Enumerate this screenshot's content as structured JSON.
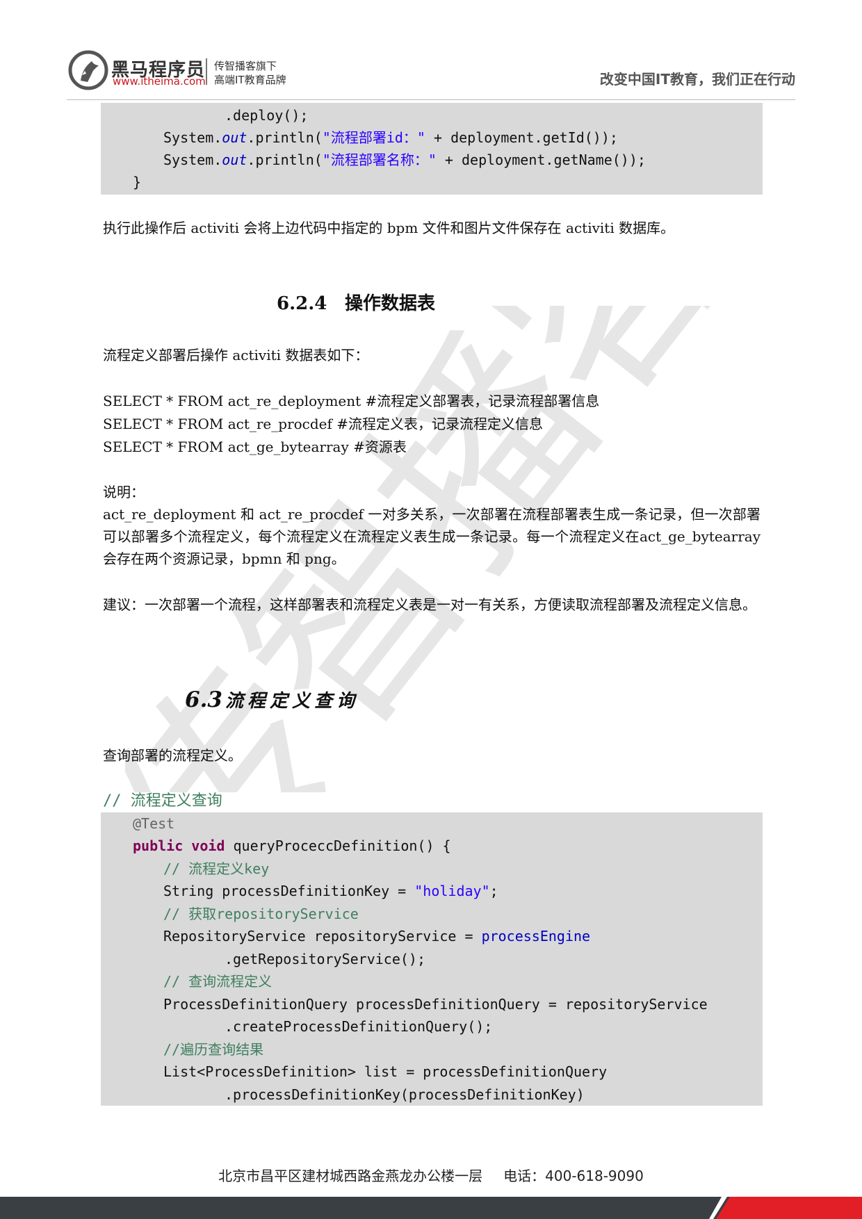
{
  "header": {
    "brand_name": "黑马程序员",
    "brand_url": "www.itheima.com",
    "brand_sub1": "传智播客旗下",
    "brand_sub2": "高端IT教育品牌",
    "slogan": "改变中国IT教育，我们正在行动"
  },
  "watermark_text": "传智播客",
  "code1": {
    "line1": ".deploy();",
    "line2_pre": "System.",
    "line2_field": "out",
    "line2_mid": ".println(",
    "line2_str": "\"流程部署id：\"",
    "line2_post": " + deployment.getId());",
    "line3_pre": "System.",
    "line3_field": "out",
    "line3_mid": ".println(",
    "line3_str": "\"流程部署名称：\"",
    "line3_post": " + deployment.getName());",
    "line4": "}"
  },
  "p_after_deploy": "执行此操作后 activiti 会将上边代码中指定的 bpm 文件和图片文件保存在 activiti 数据库。",
  "section_624": {
    "number": "6.2.4",
    "title": "操作数据表"
  },
  "p_tables_intro": "流程定义部署后操作 activiti 数据表如下：",
  "sql_lines": [
    "SELECT * FROM act_re_deployment #流程定义部署表，记录流程部署信息",
    "SELECT * FROM act_re_procdef #流程定义表，记录流程定义信息",
    "SELECT * FROM act_ge_bytearray #资源表"
  ],
  "note_label": "说明：",
  "note_body": "act_re_deployment 和 act_re_procdef 一对多关系，一次部署在流程部署表生成一条记录，但一次部署可以部署多个流程定义，每个流程定义在流程定义表生成一条记录。每一个流程定义在act_ge_bytearray 会存在两个资源记录，bpmn 和 png。",
  "advice": "建议：一次部署一个流程，这样部署表和流程定义表是一对一有关系，方便读取流程部署及流程定义信息。",
  "section_63": {
    "number": "6.3",
    "title": "流程定义查询"
  },
  "p_query_intro": "查询部署的流程定义。",
  "code_comment": "// 流程定义查询",
  "code2": {
    "ann": "@Test",
    "kw1": "public",
    "kw2": "void",
    "sig": " queryProceccDefinition() {",
    "c1": "// 流程定义key",
    "l2_pre": "String processDefinitionKey = ",
    "l2_str": "\"holiday\"",
    "l2_post": ";",
    "c2": "// 获取repositoryService",
    "l3_pre": "RepositoryService repositoryService = ",
    "l3_field": "processEngine",
    "l4": ".getRepositoryService();",
    "c3": "// 查询流程定义",
    "l5": "ProcessDefinitionQuery processDefinitionQuery = repositoryService",
    "l6": ".createProcessDefinitionQuery();",
    "c4": "//遍历查询结果",
    "l7": "List<ProcessDefinition> list = processDefinitionQuery",
    "l8": ".processDefinitionKey(processDefinitionKey)"
  },
  "footer": {
    "address": "北京市昌平区建材城西路金燕龙办公楼一层",
    "phone": "电话：400-618-9090"
  },
  "colors": {
    "code_bg": "#d9d9d9",
    "keyword": "#7f0055",
    "string": "#2a00ff",
    "comment": "#3f7f5f",
    "field": "#0000c0",
    "footer_bar": "#3a3f44",
    "footer_accent": "#e21f26"
  }
}
